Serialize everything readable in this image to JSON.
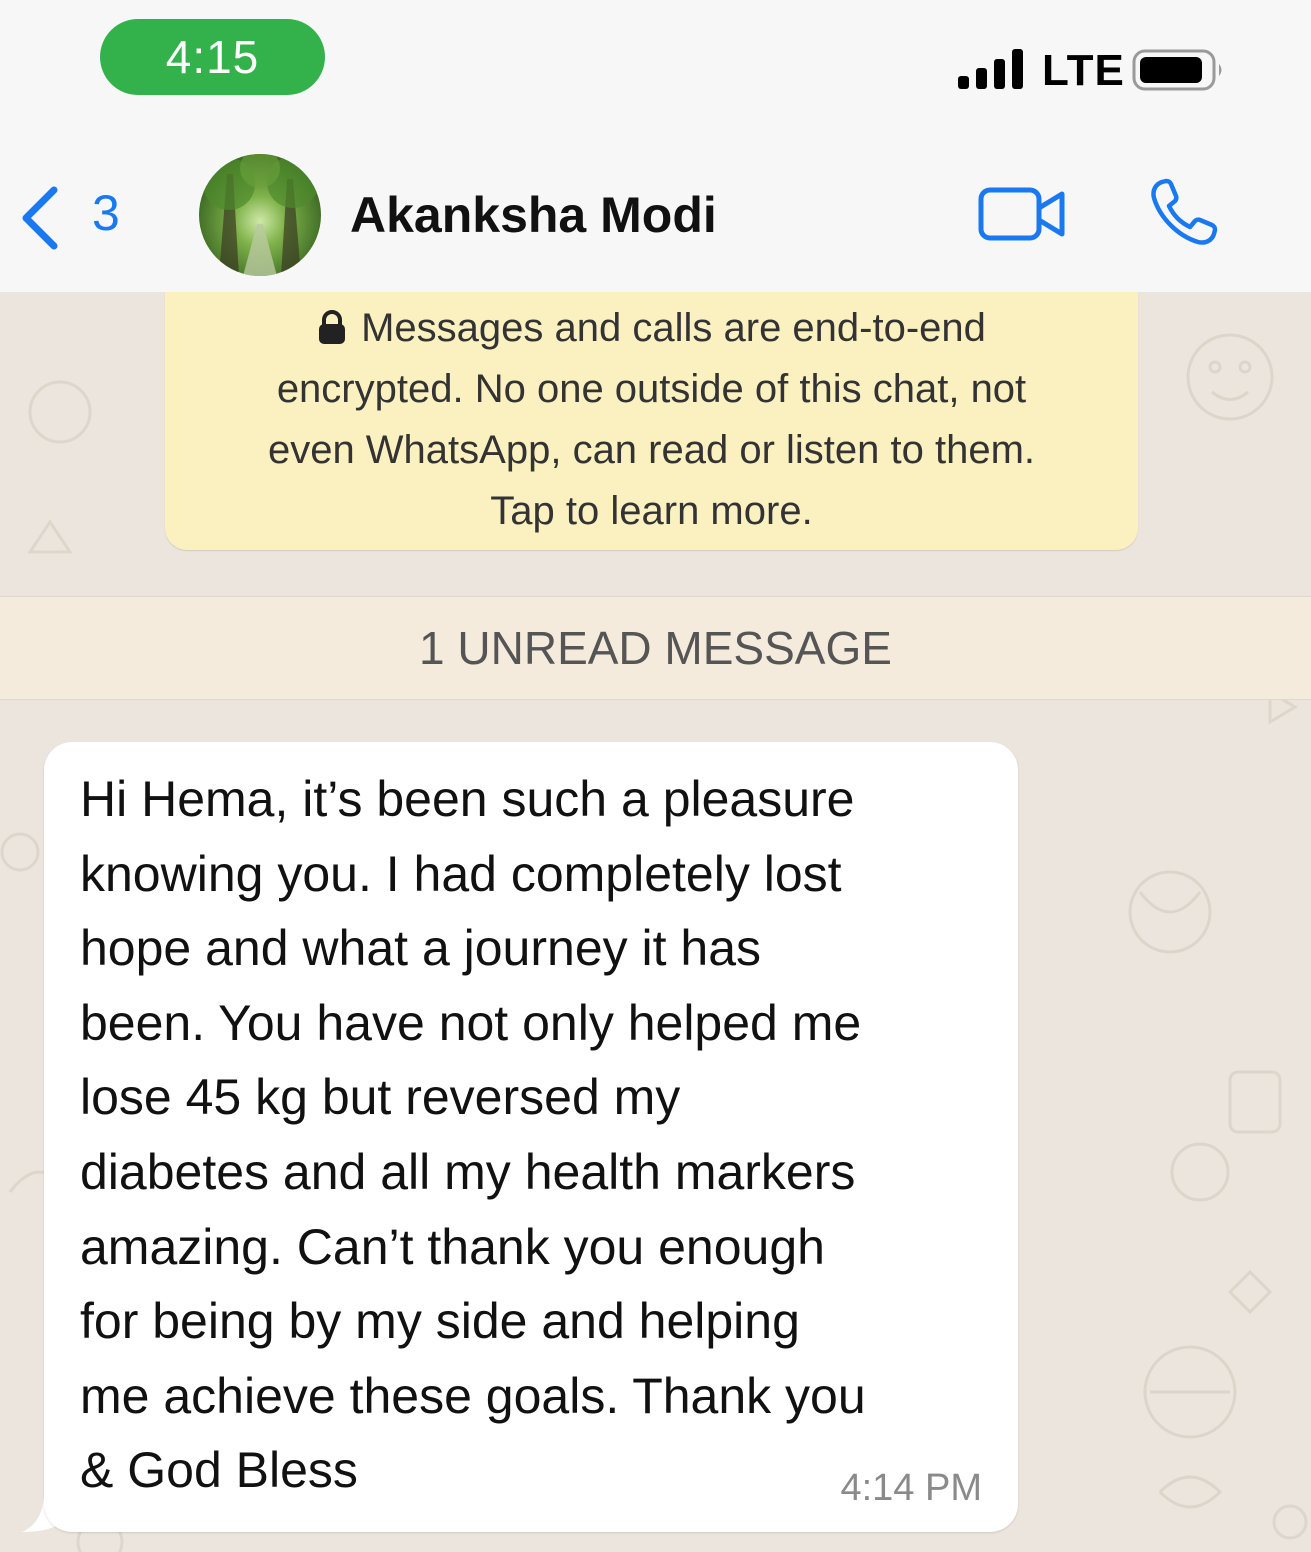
{
  "status_bar": {
    "time": "4:15",
    "network": "LTE",
    "colors": {
      "time_pill": "#33b24b"
    }
  },
  "header": {
    "back_count": "3",
    "contact_name": "Akanksha Modi",
    "icons": [
      "chevron-left-icon",
      "video-camera-icon",
      "phone-icon"
    ],
    "accent_color": "#1a79f0"
  },
  "encryption_notice": {
    "line1": "Messages and calls are end-to-end",
    "line2": "encrypted. No one outside of this chat, not",
    "line3": "even WhatsApp, can read or listen to them.",
    "line4": "Tap to learn more."
  },
  "unread_banner": "1 UNREAD MESSAGE",
  "message": {
    "lines": [
      "Hi Hema, it’s been such a pleasure",
      "knowing you. I had completely lost",
      "hope and what a journey it has",
      "been. You have not only helped me",
      "lose 45 kg but reversed my",
      "diabetes and all my health markers",
      "amazing. Can’t thank you enough",
      "for being by my side and helping",
      "me achieve these goals. Thank you",
      "& God Bless"
    ],
    "time": "4:14 PM"
  }
}
